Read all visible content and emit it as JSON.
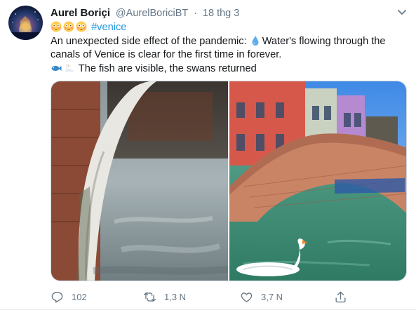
{
  "author": {
    "name": "Aurel Boriçi",
    "handle": "@AurelBoriciBT",
    "separator": "·",
    "time": "18 thg 3"
  },
  "tweet": {
    "hashtag": "#venice",
    "line2_text": "An unexpected side effect of the pandemic: ",
    "line2_after": "Water's flowing through the",
    "line3": "canals of Venice is clear for the first time in forever.",
    "line4_text": "The fish are visible, the swans returned",
    "emojis": [
      "flushed-face",
      "flushed-face",
      "flushed-face",
      "droplet",
      "fish",
      "swan"
    ]
  },
  "media": {
    "left_photo": "canal-under-bridge-photo",
    "right_photo": "bridge-swan-photo"
  },
  "actions": {
    "reply_count": "102",
    "retweet_count": "1,3 N",
    "like_count": "3,7 N"
  },
  "colors": {
    "hashtag": "#1b95e0",
    "secondary_text": "#657786",
    "border": "#e6ecf0"
  }
}
